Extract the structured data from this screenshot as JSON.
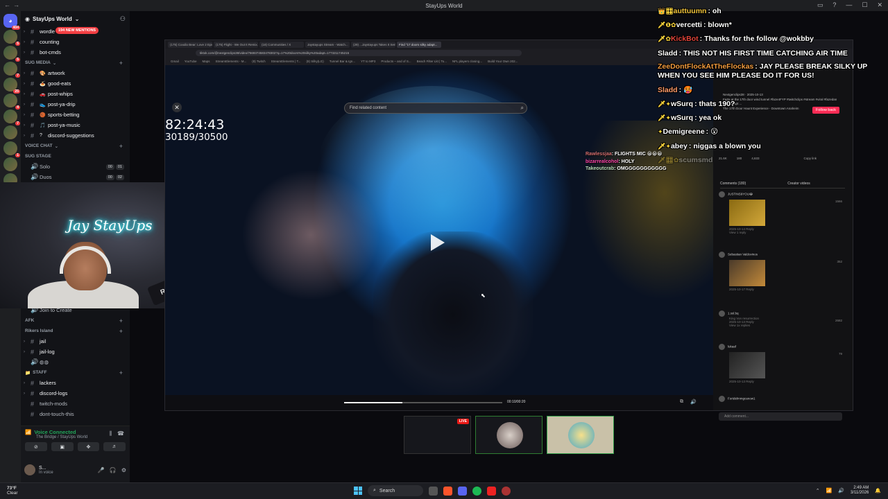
{
  "window": {
    "title": "StayUps World"
  },
  "server": {
    "name": "StayUps World",
    "mention_pill": "194 NEW MENTIONS",
    "top_channels": [
      {
        "label": "wordle",
        "emoji": ""
      },
      {
        "label": "counting",
        "emoji": ""
      },
      {
        "label": "bot-cmds",
        "emoji": ""
      }
    ],
    "cat_media": "SUG MEDIA",
    "media_channels": [
      {
        "label": "artwork",
        "emoji": "🎨"
      },
      {
        "label": "good-eats",
        "emoji": "🍝"
      },
      {
        "label": "post-whips",
        "emoji": "🚗"
      },
      {
        "label": "post-ya-drip",
        "emoji": "👟"
      },
      {
        "label": "sports-betting",
        "emoji": "🏀"
      },
      {
        "label": "post-ya-music",
        "emoji": "🎵"
      },
      {
        "label": "discord-suggestions",
        "emoji": "?"
      }
    ],
    "cat_voice": "VOICE CHAT",
    "stage": "SUG STAGE",
    "voice_channels": [
      {
        "label": "Solo",
        "a": "00",
        "b": "01"
      },
      {
        "label": "Duos",
        "a": "00",
        "b": "02"
      }
    ],
    "join_to_create": "Join to Create",
    "cat_afk": "AFK",
    "rikers": "Rikers Island",
    "jail_channels": [
      "jail",
      "jail-log"
    ],
    "cat_staff": "Staff",
    "staff_channels": [
      "lackers",
      "discord-logs",
      "twitch-mods",
      "dont-touch-this"
    ]
  },
  "voice": {
    "status": "Voice Connected",
    "location": "The Bridge / StayUps World"
  },
  "user": {
    "name": "S...",
    "status": "In voice"
  },
  "webcam": {
    "neon_sign": "Jay StayUps",
    "mic_brand": "RØDE"
  },
  "chat": [
    {
      "badges": "👑🎛",
      "name": "auttuumn",
      "color": "#f0c33c",
      "text": "oh"
    },
    {
      "badges": "🗡❶✿",
      "name": "vercetti",
      "color": "#ffffff",
      "text": "blown*"
    },
    {
      "badges": "🗡✿",
      "name": "KickBot",
      "color": "#e0433a",
      "text": "Thanks for the follow @wokbby"
    },
    {
      "badges": "",
      "name": "Sladd",
      "color": "#ffffff",
      "text": "THIS NOT HIS FIRST TIME CATCHING AIR TIME"
    },
    {
      "badges": "",
      "name": "ZeeDontFlockAtTheFlockas",
      "color": "#f09a3e",
      "text": "JAY PLEASE BREAK SILKY UP WHEN YOU SEE HIM PLEASE DO IT FOR US!"
    },
    {
      "badges": "",
      "name": "Sladd",
      "color": "#ffffff",
      "text": "🥵"
    },
    {
      "badges": "🗡✦",
      "name": "wSurq",
      "color": "#ffffff",
      "text": "thats 190?"
    },
    {
      "badges": "🗡✦",
      "name": "wSurq",
      "color": "#ffffff",
      "text": "yea ok"
    },
    {
      "badges": "✦",
      "name": "Demigreene",
      "color": "#ffffff",
      "text": "😮"
    },
    {
      "badges": "🗡✦",
      "name": "abey",
      "color": "#ffffff",
      "text": "niggas a blown you"
    },
    {
      "badges": "🗡🎛✿",
      "name": "scumsmd",
      "color": "#ffffff",
      "text": ""
    }
  ],
  "browser": {
    "tabs": [
      "(175) Coodio Bear: Love 2 Epic...",
      "(175) Flight - We Out It Remix...",
      "(18) Communities / X",
      "Jaystayups Stream - Watch...",
      "(29) ...Jaystayups Takes It Serio...",
      "Find \"17 doors silky adapt..."
    ],
    "url": "tiktok.com/@nextgenclips38/video/7569374583478302?q=17%20doors%20silky%20adapt=1773211745215",
    "bookmarks": [
      "Gmail",
      "YouTube",
      "Maps",
      "StreamElements - M...",
      "(8) Twitch",
      "StreamElements | T...",
      "(8) Silky(LG)",
      "Tunnel Bar & Ign...",
      "YT to MP3",
      "Products – and of S...",
      "Beach Filter Lkt | To...",
      "NFL players closing...",
      "Build Your Own 202..."
    ]
  },
  "video": {
    "find_placeholder": "Find related content",
    "timer": "82:24:43",
    "counter": "30189/30500",
    "time": "00:10/00:20",
    "progress": 0.37
  },
  "video_chat": [
    {
      "name": "Rawlessjaa",
      "text": "FLIGHTS MIC 😀😀😀"
    },
    {
      "name": "bizarrealcohol",
      "text": "HOLY"
    },
    {
      "name": "Takeoutcrab",
      "text": "OMGGGGGGGGGGG"
    }
  ],
  "tiktok": {
    "follow": "Follow back",
    "author": "Nextgenclips38 · 2025-10-13",
    "desc": "FaZe at the 17th door wind tunnel #faze4FYP #twitchclips #stream #viral #fazedan #fazeadapt ...",
    "location": "The 17th Door Haunt Experience - Downtown Anaheim",
    "stats": [
      "21.6K",
      "180",
      "4,633"
    ],
    "copy_link": "Copy link",
    "tab_comments": "Comments (180)",
    "tab_creator": "Creator videos",
    "comments": [
      {
        "user": "JUSTINS9YOU😂",
        "date": "2025-10-14",
        "reply": "Reply",
        "likes": "1566",
        "view": "View 1 reply"
      },
      {
        "user": "Sebastian Valdovinos",
        "date": "2025-10-17",
        "reply": "Reply",
        "likes": "352",
        "view": ""
      },
      {
        "user": "1.ssl.bq",
        "text": "King Von resurrection",
        "date": "2025-10-13",
        "reply": "Reply",
        "likes": "2682",
        "view": "View 1x replies"
      },
      {
        "user": "lukaaf",
        "date": "2025-10-13",
        "reply": "Reply",
        "likes": "79",
        "view": ""
      },
      {
        "user": "Fortdelmmgcanow1",
        "date": "",
        "reply": "",
        "likes": "",
        "view": ""
      }
    ],
    "add_comment": "Add comment..."
  },
  "thumbs": {
    "live": "LIVE"
  },
  "taskbar": {
    "weather_temp": "73°F",
    "weather_desc": "Clear",
    "search": "Search",
    "time": "2:49 AM",
    "date": "3/11/2026"
  }
}
